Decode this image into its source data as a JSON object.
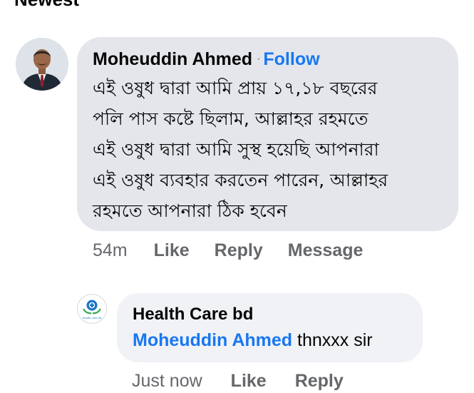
{
  "header": {
    "cut_text": "Newest"
  },
  "comment": {
    "author": "Moheuddin Ahmed",
    "separator": "·",
    "follow_label": "Follow",
    "text": "এই ওষুধ দ্বারা আমি প্রায় ১৭,১৮ বছরের\nপলি পাস কষ্টে ছিলাম, আল্লাহর রহমতে\nএই ওষুধ দ্বারা আমি সুস্থ হয়েছি আপনারা\nএই ওষুধ ব্যবহার করতেন পারেন, আল্লাহর\nরহমতে আপনারা ঠিক হবেন",
    "timestamp": "54m",
    "like_label": "Like",
    "reply_label": "Reply",
    "message_label": "Message"
  },
  "reply": {
    "author": "Health Care bd",
    "mention": "Moheuddin Ahmed",
    "text": "thnxxx sir",
    "timestamp": "Just now",
    "like_label": "Like",
    "reply_label": "Reply",
    "avatar_text": "Health care bd"
  },
  "colors": {
    "link": "#1877f2",
    "bubble_primary": "#e4e6eb",
    "bubble_reply": "#f0f2f5",
    "muted_text": "#65676b"
  },
  "icons": {
    "commenter_avatar": "profile-photo",
    "page_avatar": "health-care-logo"
  }
}
